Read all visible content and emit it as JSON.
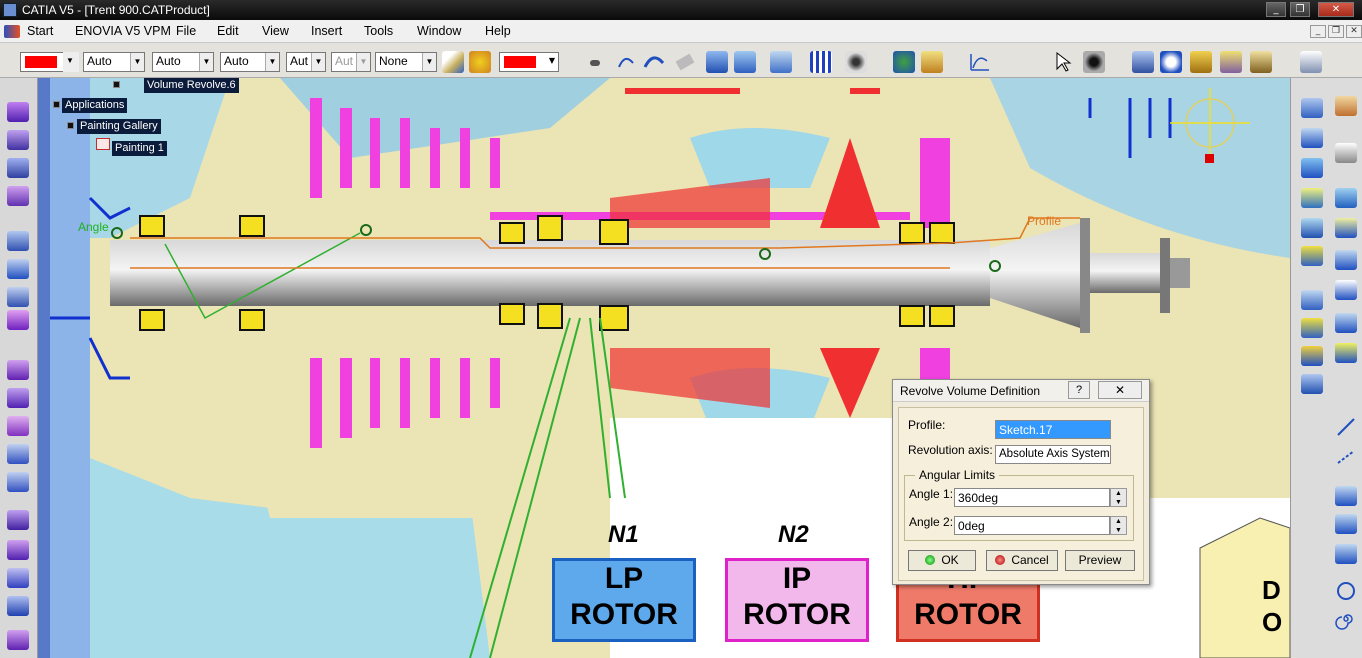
{
  "window": {
    "title": "CATIA V5 - [Trent 900.CATProduct]",
    "minimize": "_",
    "restore": "❐",
    "close": "✕"
  },
  "menubar": {
    "start": "Start",
    "enovia": "ENOVIA V5 VPM",
    "file": "File",
    "edit": "Edit",
    "view": "View",
    "insert": "Insert",
    "tools": "Tools",
    "window": "Window",
    "help": "Help",
    "mdi_min": "_",
    "mdi_restore": "❐",
    "mdi_close": "✕"
  },
  "toolbar": {
    "fill_color": "#ff0000",
    "transparency": "Auto",
    "linetype": "Auto",
    "thickness": "Auto",
    "point_symbol": "Aut",
    "layer_style": "Aut",
    "layer": "None",
    "line_color": "#ff0000"
  },
  "tree": {
    "volume_revolve": "Volume Revolve.6",
    "applications": "Applications",
    "painting_gallery": "Painting Gallery",
    "painting": "Painting 1"
  },
  "canvas": {
    "angle_label": "Angle",
    "profile_label": "Profile",
    "n1": "N1",
    "n2": "N2",
    "lp_rotor_line1": "LP",
    "lp_rotor_line2": "ROTOR",
    "ip_rotor_line1": "IP",
    "ip_rotor_line2": "ROTOR",
    "hp_rotor_line1": "HP",
    "hp_rotor_line2": "ROTOR",
    "lp_color": "#5ea8ec",
    "ip_color": "#f2b8ec",
    "hp_color": "#f07a6a",
    "partial_card_line1": "D",
    "partial_card_line2": "O"
  },
  "dialog": {
    "title": "Revolve Volume Definition",
    "help": "?",
    "close": "✕",
    "profile_label": "Profile:",
    "profile_value": "Sketch.17",
    "axis_label": "Revolution axis:",
    "axis_value": "Absolute Axis System",
    "angular_limits": "Angular Limits",
    "angle1_label": "Angle 1:",
    "angle1_value": "360deg",
    "angle2_label": "Angle 2:",
    "angle2_value": "0deg",
    "ok": "OK",
    "cancel": "Cancel",
    "preview": "Preview"
  }
}
